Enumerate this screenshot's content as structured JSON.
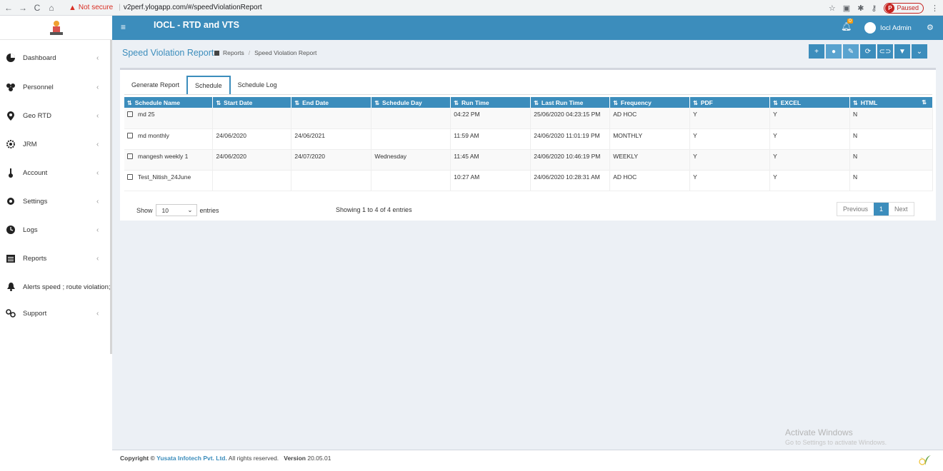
{
  "browser": {
    "not_secure": "Not secure",
    "url": "v2perf.ylogapp.com/#/speedViolationReport",
    "paused": "Paused",
    "profile_letter": "P"
  },
  "header": {
    "title": "IOCL - RTD and VTS",
    "notification_count": "0",
    "user_name": "Iocl Admin"
  },
  "sidebar": {
    "items": [
      {
        "label": "Dashboard",
        "icon": "dashboard-icon",
        "chevron": "‹"
      },
      {
        "label": "Personnel",
        "icon": "users-icon",
        "chevron": "‹"
      },
      {
        "label": "Geo RTD",
        "icon": "map-marker-icon",
        "chevron": "‹"
      },
      {
        "label": "JRM",
        "icon": "gear-icon",
        "chevron": "‹"
      },
      {
        "label": "Account",
        "icon": "thermometer-icon",
        "chevron": "‹"
      },
      {
        "label": "Settings",
        "icon": "cog-icon",
        "chevron": "‹"
      },
      {
        "label": "Logs",
        "icon": "clock-icon",
        "chevron": "‹"
      },
      {
        "label": "Reports",
        "icon": "report-icon",
        "chevron": "‹"
      },
      {
        "label": "Alerts speed ; route violation;",
        "icon": "bell-icon",
        "chevron": ""
      },
      {
        "label": "Support",
        "icon": "support-icon",
        "chevron": "‹"
      }
    ]
  },
  "page": {
    "title": "Speed Violation Report",
    "breadcrumb": [
      "Reports",
      "Speed Violation Report"
    ]
  },
  "tabs": [
    {
      "label": "Generate Report",
      "active": false
    },
    {
      "label": "Schedule",
      "active": true
    },
    {
      "label": "Schedule Log",
      "active": false
    }
  ],
  "table": {
    "columns": [
      "Schedule Name",
      "Start Date",
      "End Date",
      "Schedule Day",
      "Run Time",
      "Last Run Time",
      "Frequency",
      "PDF",
      "EXCEL",
      "HTML"
    ],
    "rows": [
      [
        "md 25",
        "",
        "",
        "",
        "04:22 PM",
        "25/06/2020 04:23:15 PM",
        "AD HOC",
        "Y",
        "Y",
        "N"
      ],
      [
        "md monthly",
        "24/06/2020",
        "24/06/2021",
        "",
        "11:59 AM",
        "24/06/2020 11:01:19 PM",
        "MONTHLY",
        "Y",
        "Y",
        "N"
      ],
      [
        "mangesh weekly 1",
        "24/06/2020",
        "24/07/2020",
        "Wednesday",
        "11:45 AM",
        "24/06/2020 10:46:19 PM",
        "WEEKLY",
        "Y",
        "Y",
        "N"
      ],
      [
        "Test_Nitish_24June",
        "",
        "",
        "",
        "10:27 AM",
        "24/06/2020 10:28:31 AM",
        "AD HOC",
        "Y",
        "Y",
        "N"
      ]
    ]
  },
  "pagination": {
    "show_label": "Show",
    "page_size": "10",
    "entries_label": "entries",
    "info": "Showing 1 to 4 of 4 entries",
    "previous": "Previous",
    "current": "1",
    "next": "Next"
  },
  "footer": {
    "copyright_prefix": "Copyright ©",
    "company": "Yusata Infotech Pvt. Ltd.",
    "rights": "All rights reserved.",
    "version_label": "Version",
    "version": "20.05.01"
  },
  "watermark": {
    "line1": "Activate Windows",
    "line2": "Go to Settings to activate Windows."
  },
  "colors": {
    "primary": "#3c8dbc",
    "background": "#ecf0f5"
  }
}
